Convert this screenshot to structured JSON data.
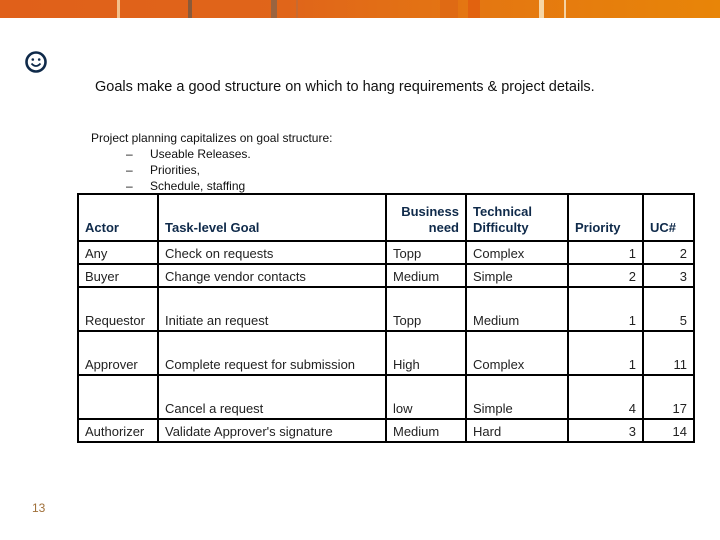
{
  "header_band": {
    "colors": [
      "#e0601a",
      "#e88508"
    ]
  },
  "icon": {
    "name": "smiley-face-icon",
    "color": "#0f2a4a"
  },
  "headline": "Goals make a good structure on which to hang requirements & project details.",
  "planning": {
    "intro": "Project planning capitalizes on goal structure:",
    "bullets": [
      {
        "dash": "–",
        "text": "Useable Releases."
      },
      {
        "dash": "–",
        "text": "Priorities,"
      },
      {
        "dash": "–",
        "text": "Schedule, staffing"
      }
    ]
  },
  "table": {
    "headers": {
      "actor": "Actor",
      "goal": "Task-level Goal",
      "need": "Business need",
      "difficulty": "Technical Difficulty",
      "priority": "Priority",
      "uc": "UC#"
    },
    "header_color": "#0f2a4a",
    "rows": [
      {
        "actor": "Any",
        "goal": "Check on requests",
        "need": "Topp",
        "difficulty": "Complex",
        "priority": "1",
        "uc": "2"
      },
      {
        "actor": "Buyer",
        "goal": "Change vendor contacts",
        "need": "Medium",
        "difficulty": "Simple",
        "priority": "2",
        "uc": "3"
      },
      {
        "actor": "Requestor",
        "goal": "Initiate an request",
        "need": "Topp",
        "difficulty": "Medium",
        "priority": "1",
        "uc": "5"
      },
      {
        "actor": "Approver",
        "goal": "Complete request for submission",
        "need": "High",
        "difficulty": "Complex",
        "priority": "1",
        "uc": "11"
      },
      {
        "actor": "",
        "goal": "Cancel a request",
        "need": "low",
        "difficulty": "Simple",
        "priority": "4",
        "uc": "17"
      },
      {
        "actor": "Authorizer",
        "goal": "Validate Approver's signature",
        "need": "Medium",
        "difficulty": "Hard",
        "priority": "3",
        "uc": "14"
      }
    ]
  },
  "page_number": "13"
}
